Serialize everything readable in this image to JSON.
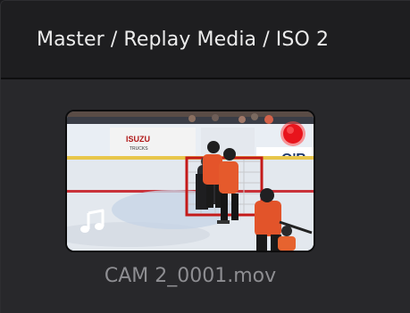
{
  "header": {
    "breadcrumb": "Master / Replay Media / ISO 2"
  },
  "bin": {
    "clips": [
      {
        "name": "CAM 2_0001.mov",
        "badges": [
          "record-indicator-icon",
          "audio-note-icon"
        ],
        "colors": {
          "record": "#e8141c",
          "audio": "#ffffff"
        }
      }
    ]
  },
  "colors": {
    "header_bg": "#1e1e20",
    "bin_bg": "#28282b",
    "title_text": "#ececec",
    "clip_name_text": "#8e8e92"
  }
}
